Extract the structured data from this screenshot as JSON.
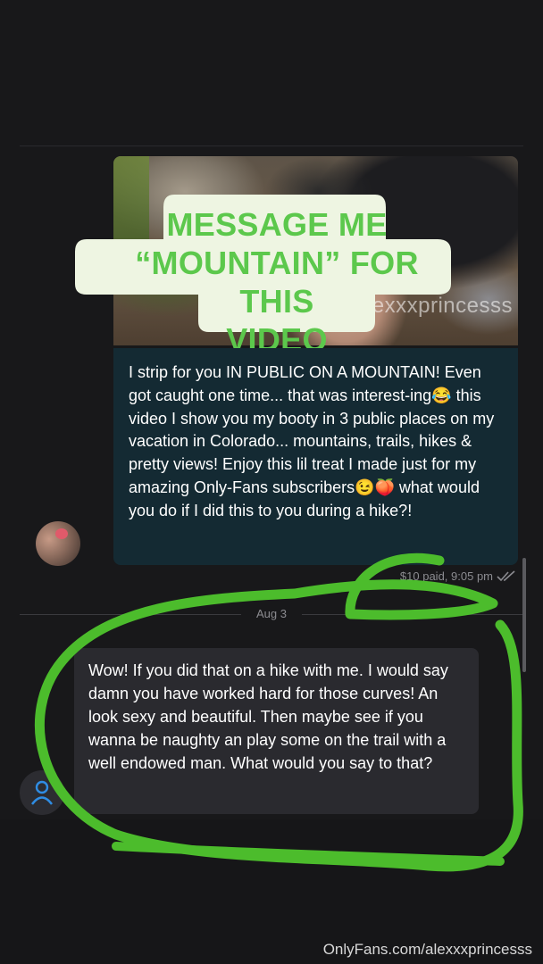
{
  "overlay": {
    "lines": [
      "MESSAGE ME",
      "“MOUNTAIN” FOR THIS",
      "VIDEO"
    ]
  },
  "media": {
    "watermark": "alexxxprincesss"
  },
  "message_out": {
    "text": "I strip for you IN PUBLIC ON A MOUNTAIN! Even got caught one time... that was interest-ing😂 this video I show you my booty in 3 public places on my vacation in Colorado... mountains, trails, hikes & pretty views! Enjoy this lil treat I made just for my amazing Only-Fans subscribers😉🍑 what would you do if I did this to you during a hike?!",
    "meta": "$10 paid, 9:05 pm"
  },
  "date_separator": "Aug 3",
  "message_in": {
    "text": "Wow! If you did that on a hike with me. I would say damn you have worked hard for those curves! An look sexy and beautiful. Then maybe see if you wanna be naughty an play some on the trail with a well endowed man. What would you say to that?"
  },
  "footer": {
    "watermark": "OnlyFans.com/alexxxprincesss"
  },
  "colors": {
    "background": "#18181a",
    "outgoing_bubble": "#142a33",
    "incoming_bubble": "#2a2a2f",
    "overlay_text": "#5cc84c",
    "scribble": "#4cbc2c"
  },
  "icons": {
    "read_receipt": "double-check-icon",
    "me_avatar": "user-icon"
  }
}
